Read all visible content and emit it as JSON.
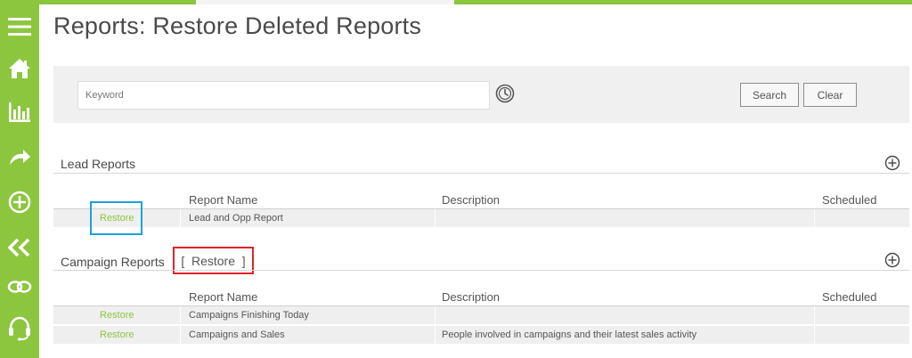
{
  "page": {
    "title": "Reports: Restore Deleted Reports"
  },
  "sidebar": {
    "items": [
      {
        "icon": "menu-icon"
      },
      {
        "icon": "home-icon"
      },
      {
        "icon": "bar-chart-icon"
      },
      {
        "icon": "forward-arrow-icon"
      },
      {
        "icon": "add-circle-icon"
      },
      {
        "icon": "double-chevron-left-icon"
      },
      {
        "icon": "linked-rings-icon"
      },
      {
        "icon": "headset-icon"
      }
    ],
    "color": "#8cc63f"
  },
  "search": {
    "placeholder": "Keyword",
    "search_label": "Search",
    "clear_label": "Clear"
  },
  "lead_reports": {
    "title": "Lead Reports",
    "columns": [
      "Report Name",
      "Description",
      "Scheduled"
    ],
    "rows": [
      {
        "action": "Restore",
        "name": "Lead and Opp Report",
        "description": "",
        "scheduled": ""
      }
    ]
  },
  "campaign_reports": {
    "title": "Campaign Reports",
    "restore_all_label": "[  Restore  ]",
    "columns": [
      "Report Name",
      "Description",
      "Scheduled"
    ],
    "rows": [
      {
        "action": "Restore",
        "name": "Campaigns Finishing Today",
        "description": "",
        "scheduled": ""
      },
      {
        "action": "Restore",
        "name": "Campaigns and Sales",
        "description": "People involved in campaigns and their latest sales activity",
        "scheduled": ""
      }
    ]
  },
  "colors": {
    "accent": "#8cc63f",
    "highlight_blue": "#1aa1e0",
    "highlight_red": "#e0242d"
  }
}
